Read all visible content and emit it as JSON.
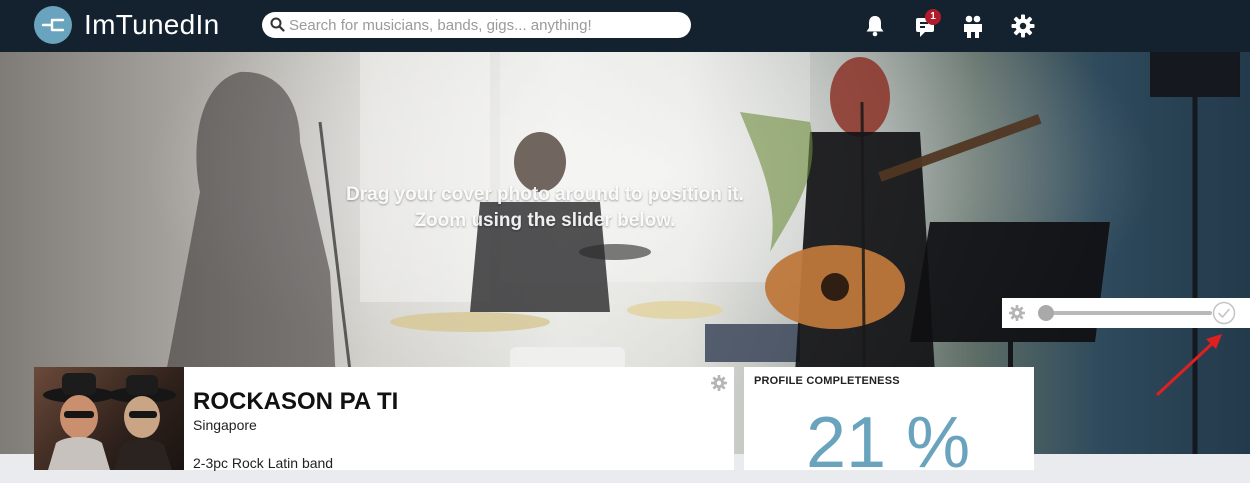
{
  "app": {
    "brand": "ImTunedIn",
    "logo_icon": "tuning-fork-icon"
  },
  "search": {
    "placeholder": "Search for musicians, bands, gigs... anything!",
    "value": ""
  },
  "nav": {
    "notifications_icon": "bell-icon",
    "messages_icon": "chat-icon",
    "messages_badge": "1",
    "people_icon": "people-icon",
    "settings_icon": "gear-icon"
  },
  "cover": {
    "hint_line1": "Drag your cover photo around to position it.",
    "hint_line2": "Zoom using the slider below.",
    "zoom_level": 0.0
  },
  "profile": {
    "name": "ROCKASON PA TI",
    "location": "Singapore",
    "description": "2-3pc Rock Latin band"
  },
  "completeness": {
    "title": "PROFILE COMPLETENESS",
    "value_text": "21 %",
    "value": 21
  },
  "colors": {
    "topbar": "#13222e",
    "accent": "#6aa3bd",
    "badge": "#b31b2a",
    "annotation_arrow": "#e02020"
  }
}
